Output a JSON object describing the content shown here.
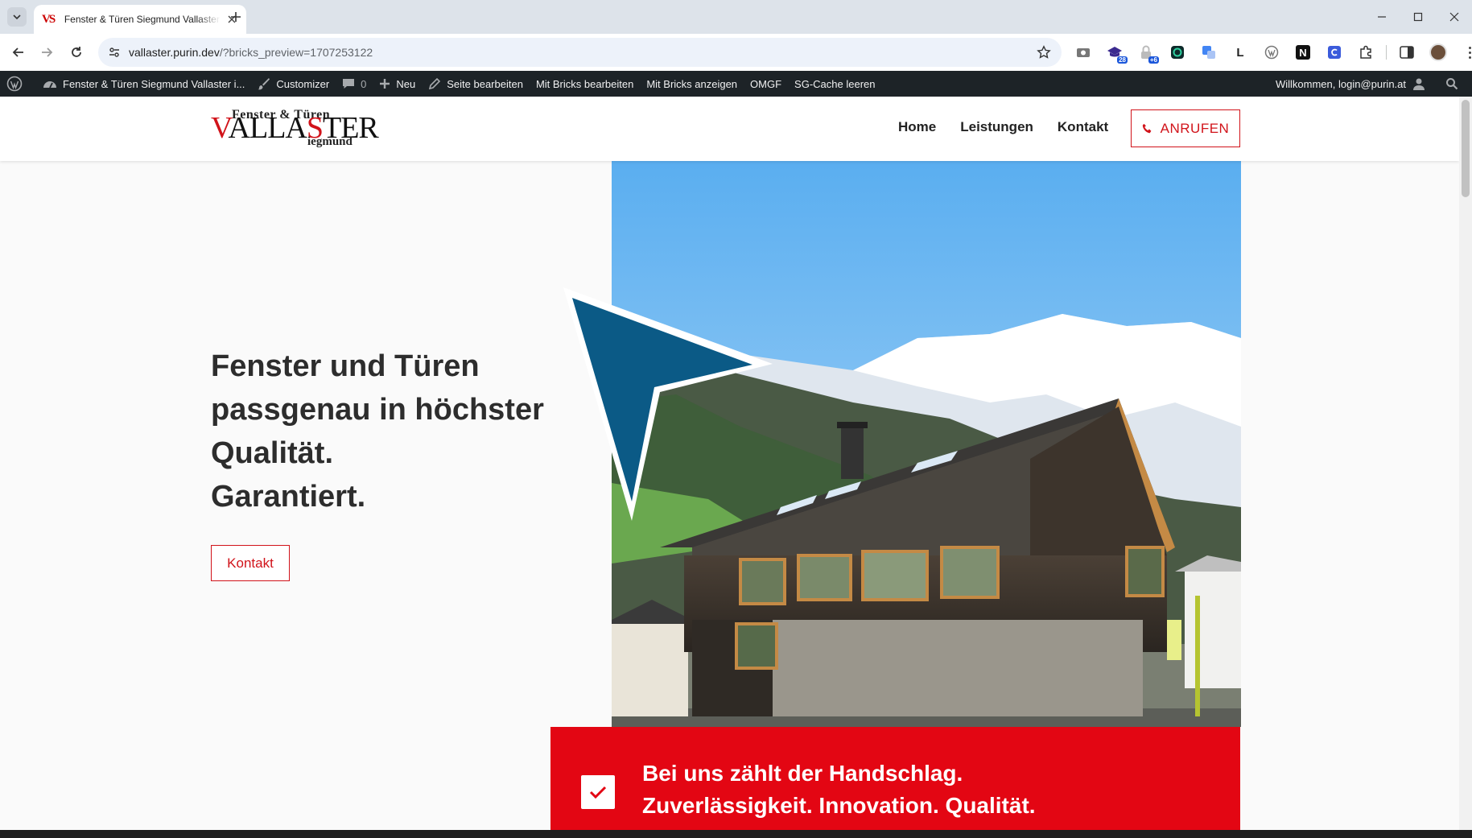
{
  "browser": {
    "tab_title": "Fenster & Türen Siegmund Vallaster i...",
    "favicon_text": "VS",
    "url_host": "vallaster.purin.dev",
    "url_path": "/?bricks_preview=1707253122",
    "extensions": [
      {
        "icon": "camera-icon"
      },
      {
        "icon": "graduation-cap-icon",
        "badge": "28"
      },
      {
        "icon": "lock-icon",
        "badge": "+6"
      },
      {
        "icon": "grammarly-icon"
      },
      {
        "icon": "translate-icon"
      },
      {
        "icon": "letter-l-icon",
        "text": "L"
      },
      {
        "icon": "wordpress-icon"
      },
      {
        "icon": "notion-icon",
        "text": "N"
      },
      {
        "icon": "c-icon"
      },
      {
        "icon": "puzzle-icon"
      }
    ]
  },
  "adminbar": {
    "site_name": "Fenster & Türen Siegmund Vallaster i...",
    "customizer": "Customizer",
    "comments_count": "0",
    "new": "Neu",
    "edit_page": "Seite bearbeiten",
    "edit_bricks": "Mit Bricks bearbeiten",
    "view_bricks": "Mit Bricks anzeigen",
    "omgf": "OMGF",
    "sg_cache": "SG-Cache leeren",
    "welcome": "Willkommen, login@purin.at"
  },
  "site": {
    "logo_top": "Fenster & Türen",
    "logo_main_1": "V",
    "logo_main_2": "ALLA",
    "logo_main_3": "S",
    "logo_main_4": "TER",
    "logo_sub": "iegmund",
    "nav": [
      "Home",
      "Leistungen",
      "Kontakt"
    ],
    "call_button": "ANRUFEN",
    "hero_lines": [
      "Fenster und Türen",
      "passgenau in höchster",
      "Qualität.",
      "Garantiert."
    ],
    "contact_button": "Kontakt",
    "banner_line1": "Bei uns zählt der Handschlag.",
    "banner_line2": "Zuverlässigkeit. Innovation. Qualität."
  },
  "colors": {
    "brand_red": "#e30613",
    "accent_blue": "#0b5a86",
    "adminbar": "#1d2327"
  }
}
